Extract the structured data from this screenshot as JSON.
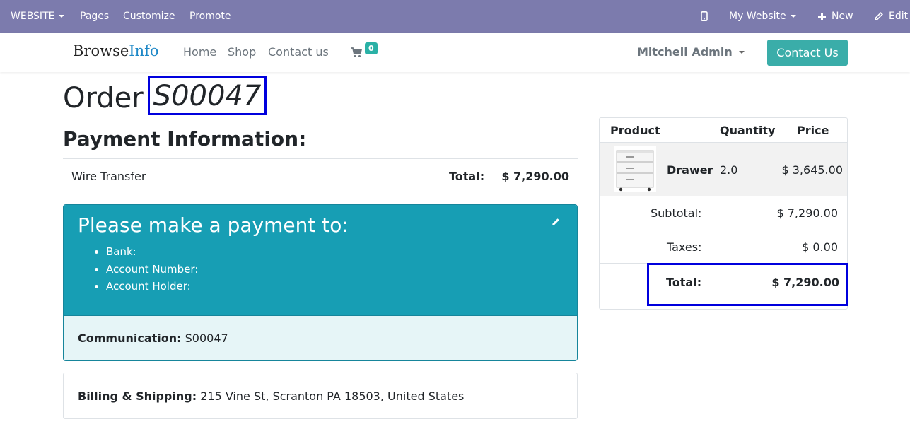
{
  "admin_bar": {
    "website_menu": "WEBSITE",
    "pages": "Pages",
    "customize": "Customize",
    "promote": "Promote",
    "site_selector": "My Website",
    "new": "New",
    "edit": "Edit",
    "bg_color": "#7c7bad"
  },
  "navbar": {
    "logo_part1": "Browse",
    "logo_part2": "Info",
    "links": [
      "Home",
      "Shop",
      "Contact us"
    ],
    "cart_count": "0",
    "user": "Mitchell Admin",
    "contact_button": "Contact Us",
    "accent_color": "#3aada9"
  },
  "order": {
    "title_prefix": "Order",
    "id": "S00047"
  },
  "payment": {
    "heading": "Payment Information:",
    "method": "Wire Transfer",
    "total_label": "Total:",
    "total_value": "$ 7,290.00"
  },
  "instructions": {
    "heading": "Please make a payment to:",
    "items": [
      "Bank:",
      "Account Number:",
      "Account Holder:"
    ],
    "communication_label": "Communication:",
    "communication_value": "S00047",
    "color": "#179eb4"
  },
  "billing": {
    "label": "Billing & Shipping:",
    "address": "215 Vine St, Scranton PA 18503, United States"
  },
  "summary": {
    "headers": [
      "Product",
      "Quantity",
      "Price"
    ],
    "line": {
      "product": "Drawer",
      "quantity": "2.0",
      "price": "$ 3,645.00"
    },
    "subtotal_label": "Subtotal:",
    "subtotal_value": "$ 7,290.00",
    "taxes_label": "Taxes:",
    "taxes_value": "$ 0.00",
    "total_label": "Total:",
    "total_value": "$ 7,290.00"
  }
}
